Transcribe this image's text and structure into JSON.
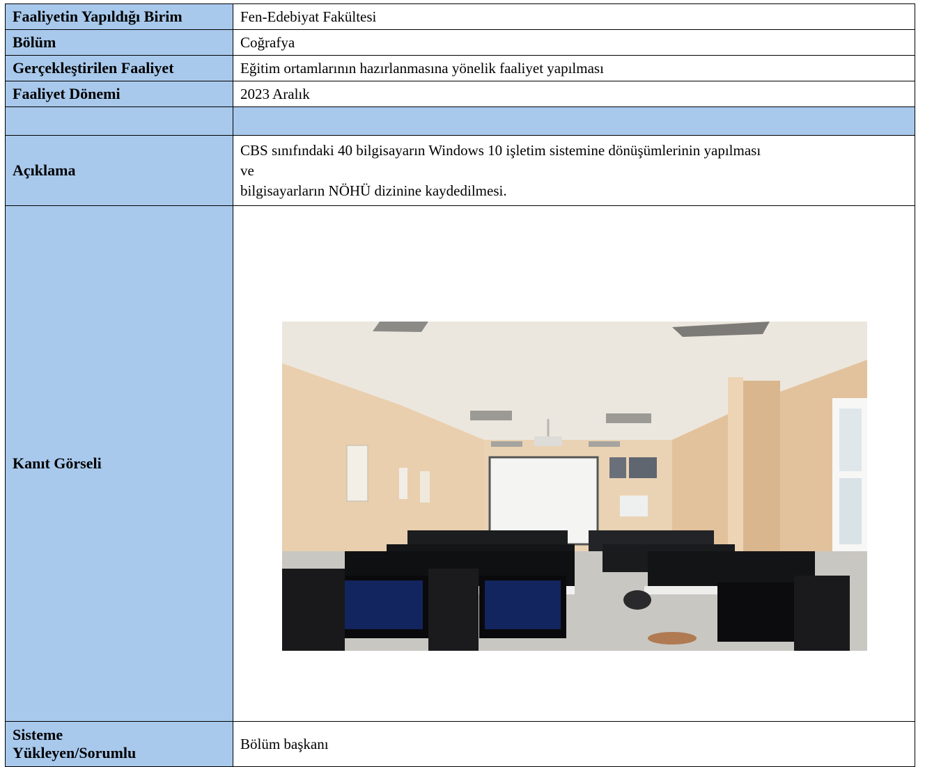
{
  "rows": {
    "unit_label": "Faaliyetin Yapıldığı Birim",
    "unit_value": "Fen-Edebiyat Fakültesi",
    "dept_label": "Bölüm",
    "dept_value": "Coğrafya",
    "activity_label": "Gerçekleştirilen Faaliyet",
    "activity_value": "Eğitim ortamlarının hazırlanmasına yönelik faaliyet yapılması",
    "period_label": "Faaliyet Dönemi",
    "period_value": "2023 Aralık",
    "desc_label": "Açıklama",
    "desc_line1": "CBS sınıfındaki 40 bilgisayarın Windows 10 işletim sistemine dönüşümlerinin yapılması",
    "desc_line2": "ve",
    "desc_line3": "bilgisayarların NÖHÜ dizinine kaydedilmesi.",
    "evidence_label": "Kanıt Görseli",
    "uploader_label_line1": "Sisteme",
    "uploader_label_line2": "Yükleyen/Sorumlu",
    "uploader_value": "Bölüm başkanı"
  },
  "photo": {
    "subject": "computer-lab-classroom-photo"
  }
}
